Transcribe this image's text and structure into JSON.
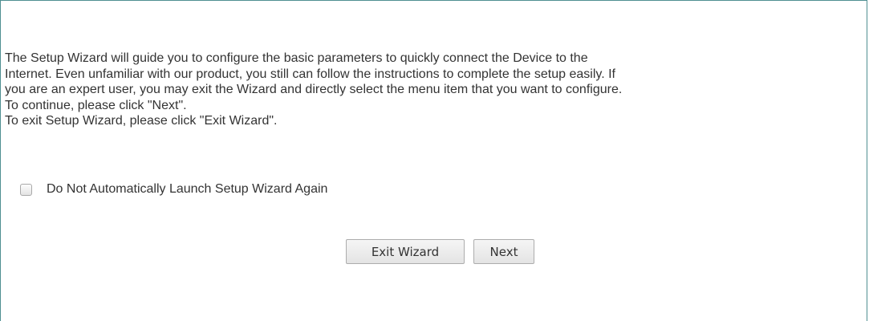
{
  "wizard": {
    "intro_lines": [
      "The Setup Wizard will guide you to configure the basic parameters to quickly connect the Device to the",
      "Internet. Even unfamiliar with our product, you still can follow the instructions to complete the setup easily. If",
      "you are an expert user, you may exit the Wizard and directly select the menu item that you want to configure.",
      "To continue, please click \"Next\".",
      "To exit Setup Wizard, please click \"Exit Wizard\"."
    ],
    "checkbox_label": "Do Not Automatically Launch Setup Wizard Again",
    "checkbox_checked": false,
    "exit_button_label": "Exit Wizard",
    "next_button_label": "Next"
  }
}
